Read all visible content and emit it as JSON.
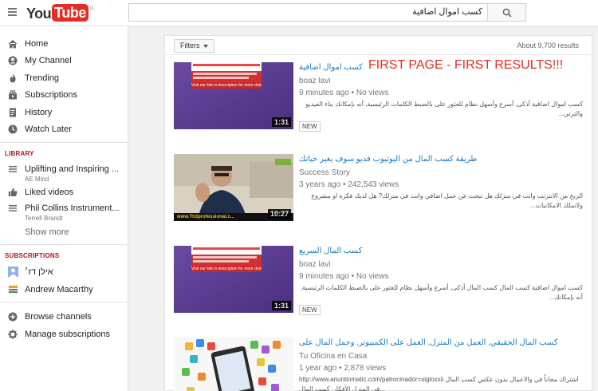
{
  "header": {
    "logo_you": "You",
    "logo_tube": "Tube",
    "logo_country": "IL",
    "search_value": "كسب اموال اضافية"
  },
  "sidebar": {
    "main_items": [
      {
        "label": "Home",
        "icon": "home-icon"
      },
      {
        "label": "My Channel",
        "icon": "person-icon"
      },
      {
        "label": "Trending",
        "icon": "flame-icon"
      },
      {
        "label": "Subscriptions",
        "icon": "subscriptions-icon"
      },
      {
        "label": "History",
        "icon": "history-icon"
      },
      {
        "label": "Watch Later",
        "icon": "clock-icon"
      }
    ],
    "library_title": "LIBRARY",
    "library_items": [
      {
        "label": "Uplifting and Inspiring ...",
        "sub": "AE Mind",
        "icon": "playlist-icon"
      },
      {
        "label": "Liked videos",
        "sub": "",
        "icon": "thumbs-up-icon"
      },
      {
        "label": "Phil Collins Instrument...",
        "sub": "Terrell Brandt",
        "icon": "playlist-icon"
      }
    ],
    "show_more": "Show more",
    "subscriptions_title": "SUBSCRIPTIONS",
    "subscription_items": [
      {
        "label": "אילן דז׳",
        "icon": "user-avatar-icon"
      },
      {
        "label": "Andrew Macarthy",
        "icon": "channel-avatar-icon"
      }
    ],
    "footer_items": [
      {
        "label": "Browse channels",
        "icon": "plus-circle-icon"
      },
      {
        "label": "Manage subscriptions",
        "icon": "gear-icon"
      }
    ]
  },
  "filters": {
    "button_label": "Filters",
    "results_count": "About 9,700 results"
  },
  "annotation": "FIRST PAGE - FIRST RESULTS!!!",
  "results": [
    {
      "title": "كسب اموال اضافية",
      "channel": "boaz lavi",
      "age": "9 minutes ago",
      "views": "No views",
      "description": "كسب اموال اضافية أذكى, أسرع وأسهل نظام للعثور على بالضبط الكلمات الرئيسية, أنه بإمكانك بناء الفيديو والترتي...",
      "badge": "NEW",
      "duration": "1:31",
      "thumb_caption": "Visit our link in description for more details"
    },
    {
      "title": "طريقة كسب المال من اليوتيوب فديو سوف يغير حياتك",
      "channel": "Success Story",
      "age": "3 years ago",
      "views": "242,543 views",
      "description": "الربح من الانترنت وانت في منزلك هل تبحث عن عمل اضافي وانت في منزلك? هل لديك فكرة او مشروع ولاتملك الامكانيات...",
      "badge": "",
      "duration": "10:27",
      "thumb_caption": "www.Th3professional.c..."
    },
    {
      "title": "كسب المال السريع",
      "channel": "boaz lavi",
      "age": "9 minutes ago",
      "views": "No views",
      "description": "كسب اموال اضافية كسب المال كسب المال أذكى, أسرع وأسهل نظام للعثور على بالضبط الكلمات الرئيسية, أنه بإمكانك...",
      "badge": "NEW",
      "duration": "1:31",
      "thumb_caption": "Visit our link in description for more details"
    },
    {
      "title": "كسب المال الحقيقي, العمل من المنزل, العمل على الكمبيوتر, وجمل المال على",
      "channel": "Tu Oficina en Casa",
      "age": "1 year ago",
      "views": "2,878 views",
      "description": "http://www.anuntiomatic.com/patrocinador=sigloxxii اشتراك مجاناً في والاعمال بدون عكس كسب المال في المنزل الأفكار, كسب المال...",
      "badge": "",
      "duration": "",
      "thumb_caption": ""
    }
  ],
  "colors": {
    "brand_red": "#e52d27",
    "link_blue": "#167ac6",
    "section_red": "#b31217"
  }
}
